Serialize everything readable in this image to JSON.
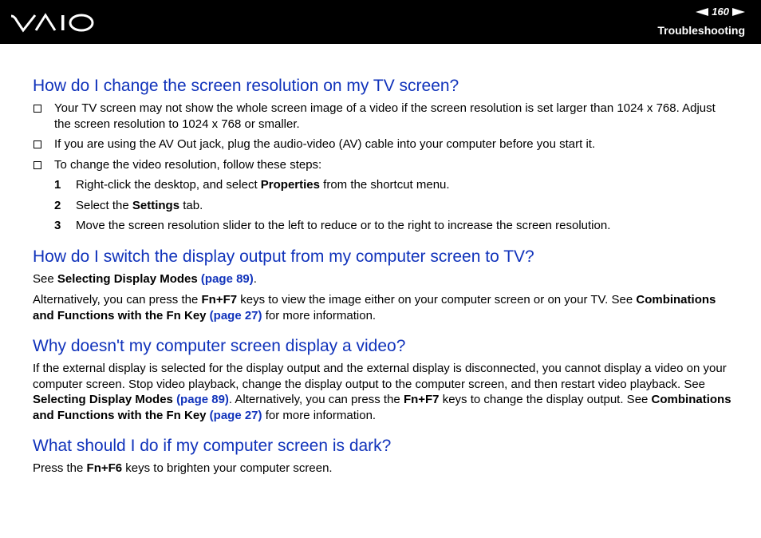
{
  "header": {
    "brand": "VAIO",
    "page_number": "160",
    "section": "Troubleshooting"
  },
  "q1": {
    "title": "How do I change the screen resolution on my TV screen?",
    "b1": "Your TV screen may not show the whole screen image of a video if the screen resolution is set larger than 1024 x 768. Adjust the screen resolution to 1024 x 768 or smaller.",
    "b2": "If you are using the AV Out jack, plug the audio-video (AV) cable into your computer before you start it.",
    "b3": "To change the video resolution, follow these steps:",
    "steps": [
      {
        "num": "1",
        "pre": "Right-click the desktop, and select ",
        "bold": "Properties",
        "post": " from the shortcut menu."
      },
      {
        "num": "2",
        "pre": "Select the ",
        "bold": "Settings",
        "post": " tab."
      },
      {
        "num": "3",
        "text": "Move the screen resolution slider to the left to reduce or to the right to increase the screen resolution."
      }
    ]
  },
  "q2": {
    "title": "How do I switch the display output from my computer screen to TV?",
    "p1_pre": "See ",
    "p1_bold": "Selecting Display Modes",
    "p1_link": "(page 89)",
    "p1_post": ".",
    "p2_a": "Alternatively, you can press the ",
    "p2_key": "Fn+F7",
    "p2_b": " keys to view the image either on your computer screen or on your TV. See ",
    "p2_bold": "Combinations and Functions with the Fn Key",
    "p2_link": "(page 27)",
    "p2_c": " for more information."
  },
  "q3": {
    "title": "Why doesn't my computer screen display a video?",
    "a": "If the external display is selected for the display output and the external display is disconnected, you cannot display a video on your computer screen. Stop video playback, change the display output to the computer screen, and then restart video playback. See ",
    "bold1": "Selecting Display Modes",
    "link1": "(page 89)",
    "b": ". Alternatively, you can press the ",
    "key": "Fn+F7",
    "c": " keys to change the display output. See ",
    "bold2": "Combinations and Functions with the Fn Key",
    "link2": "(page 27)",
    "d": " for more information."
  },
  "q4": {
    "title": "What should I do if my computer screen is dark?",
    "pre": "Press the ",
    "key": "Fn+F6",
    "post": " keys to brighten your computer screen."
  }
}
